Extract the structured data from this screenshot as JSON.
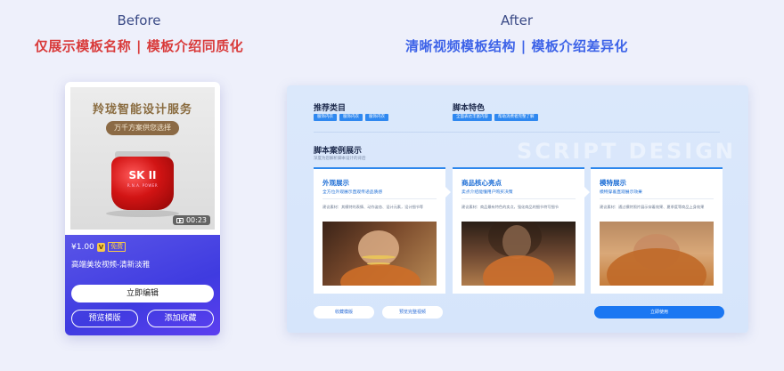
{
  "before": {
    "heading": "Before",
    "subheading": "仅展示模板名称 | 模板介绍同质化",
    "card": {
      "ad_title": "羚珑智能设计服务",
      "ad_pill": "万千方案供您选择",
      "product_brand": "SK II",
      "product_sub": "R.N.A. POWER",
      "duration": "00:23",
      "price": "¥1.00",
      "vip_badge": "V",
      "free_badge": "免费",
      "name": "高端美妆视频-清新淡雅",
      "edit_button": "立即编辑",
      "preview_button": "预览模版",
      "favorite_button": "添加收藏"
    }
  },
  "after": {
    "heading": "After",
    "subheading": "清晰视频模板结构 | 模板介绍差异化",
    "recommend": {
      "title": "推荐类目",
      "tags": [
        "服饰内衣",
        "服饰内衣",
        "服饰内衣"
      ]
    },
    "features": {
      "title": "脚本特色",
      "tags": [
        "全面表达丰富内容",
        "帮助消费者完整了解"
      ]
    },
    "watermark": "SCRIPT DESIGN",
    "script_title": "脚本案例展示",
    "script_subtitle": "深度为您解析脚本设计的背后",
    "columns": [
      {
        "title": "外观展示",
        "desc": "全方位外观展示直观传递品质感",
        "tip": "建议素材：其模特的表情、动作姿态、设计元素，设计细节等"
      },
      {
        "title": "商品核心亮点",
        "desc": "卖点介绍能懂用户购买决策",
        "tip": "建议素材：商品最有特色的卖点，强化商品的细节特写细节"
      },
      {
        "title": "模特展示",
        "desc": "模特穿着直观展示效果",
        "tip": "建议素材：通过模特照片展示穿着效果、夏季度等商品上身效果"
      }
    ],
    "buttons": {
      "favorite": "收藏模版",
      "preview": "预览完整视频",
      "use": "立即使用"
    }
  }
}
